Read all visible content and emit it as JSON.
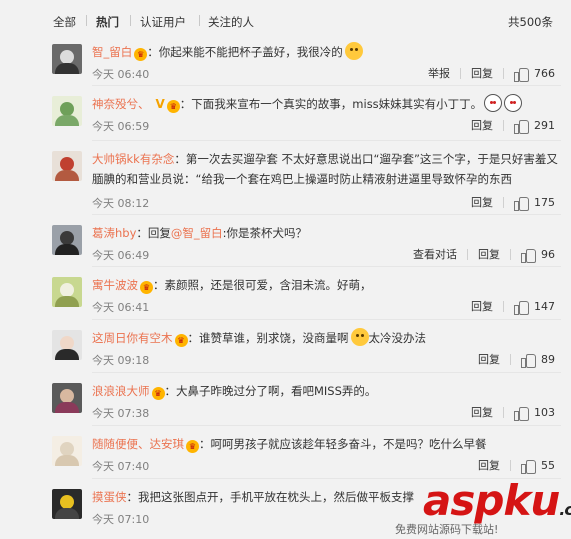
{
  "filter": {
    "tabs": [
      "全部",
      "热门",
      "认证用户",
      "关注的人"
    ],
    "active": 1,
    "total": "共500条"
  },
  "actions": {
    "report": "举报",
    "reply": "回复",
    "view_conversation": "查看对话"
  },
  "comments": [
    {
      "user": "智_留白",
      "badges": [
        "vip"
      ],
      "text": "：你起来能不能把杯子盖好，我很冷的",
      "emoji_after": "doge",
      "time": "今天 06:40",
      "likes": "766",
      "has_report": true
    },
    {
      "user": "神奈殁兮、",
      "badges": [
        "V",
        "vip"
      ],
      "text": "：下面我来宣布一个真实的故事，miss妹妹其实有小丁丁。",
      "emoji_after": "two-faces",
      "time": "今天 06:59",
      "likes": "291"
    },
    {
      "user": "大帅锅kk有杂念",
      "badges": [],
      "text": "：第一次去买遛孕套 不太好意思说出口“遛孕套”这三个字，于是只好害羞又腼腆的和营业员说：“给我一个套在鸡巴上操逼时防止精液射进逼里导致怀孕的东西",
      "time": "今天 08:12",
      "likes": "175"
    },
    {
      "user": "葛涛hby",
      "badges": [],
      "text_prefix": "：回复",
      "reply_to": "@智_留白",
      "text": ":你是茶杯犬吗？",
      "time": "今天 06:49",
      "likes": "96",
      "has_view_conversation": true
    },
    {
      "user": "寓牛波波",
      "badges": [
        "vip"
      ],
      "text": "：素颜照，还是很可爱，含泪未流。好萌，",
      "time": "今天 06:41",
      "likes": "147"
    },
    {
      "user": "这周日你有空木",
      "badges": [
        "vip"
      ],
      "text": "：谁赞草谁，别求饶，没商量啊",
      "emoji_after": "cat",
      "text_after": "太冷没办法",
      "time": "今天 09:18",
      "likes": "89"
    },
    {
      "user": "浪浪浪大师",
      "badges": [
        "vip"
      ],
      "text": "：大鼻子昨晚过分了啊，看吧MISS弄的。",
      "time": "今天 07:38",
      "likes": "103"
    },
    {
      "user": "随随便便、达安琪",
      "badges": [
        "vip"
      ],
      "text": "：呵呵男孩子就应该趁年轻多奋斗，不是吗？吃什么早餐",
      "time": "今天 07:40",
      "likes": "55"
    },
    {
      "user": "摸蛋侠",
      "badges": [],
      "text": "：我把这张图点开，手机平放在枕头上，然后做平板支撑",
      "time": "今天 07:10",
      "likes": ""
    }
  ],
  "watermark": {
    "brand_a": "asp",
    "brand_b": "ku",
    "brand_dot": ".com",
    "sub": "免费网站源码下载站!"
  },
  "colors": {
    "username": "#eb7350",
    "meta": "#808080",
    "vip": "#f6a623"
  }
}
